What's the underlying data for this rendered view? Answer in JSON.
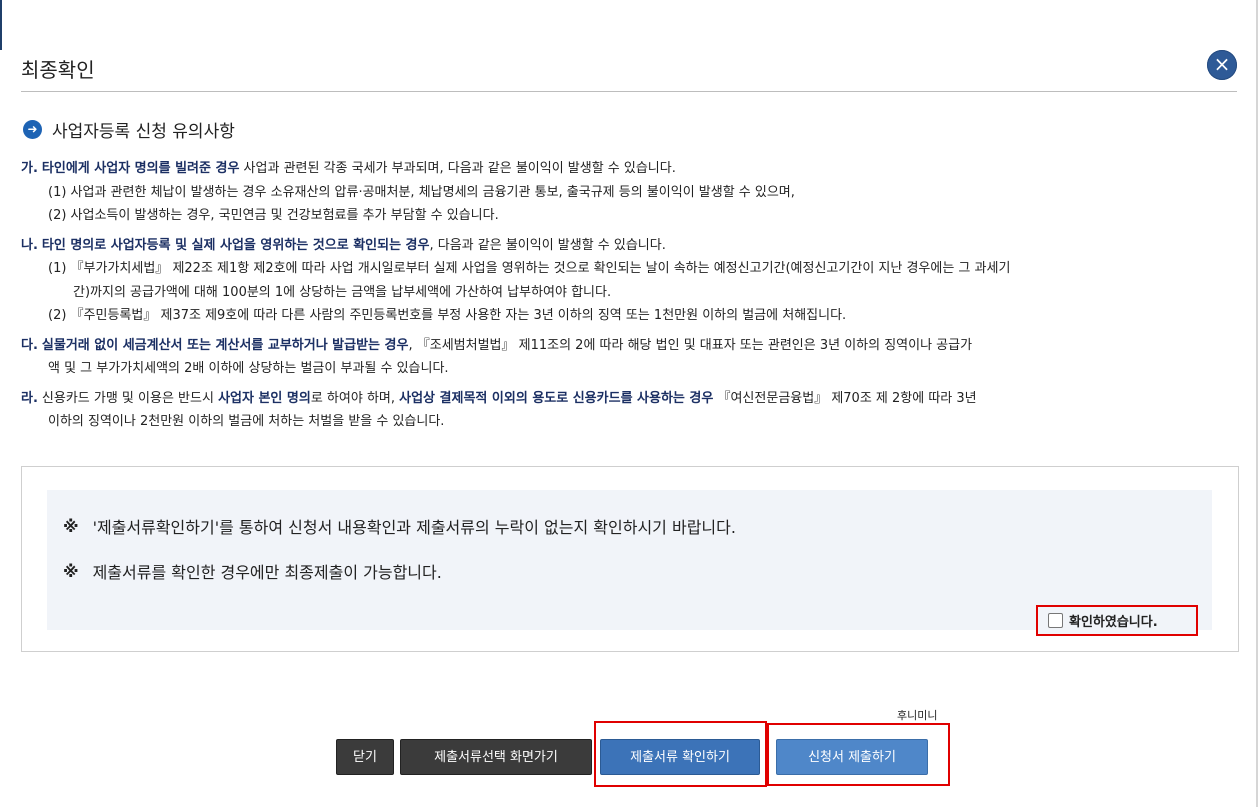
{
  "dialog": {
    "title": "최종확인",
    "close_symbol": "×"
  },
  "icons": {
    "close": "close-icon",
    "section_bullet": "arrow-right-circle-icon"
  },
  "section": {
    "icon_glyph": "➜",
    "title": "사업자등록 신청 유의사항"
  },
  "notice": {
    "ga": {
      "mark": "가.",
      "lead_bold": "타인에게 사업자 명의를 빌려준 경우",
      "lead_rest": " 사업과 관련된 각종 국세가 부과되며, 다음과 같은 불이익이 발생할 수 있습니다.",
      "item1": "(1) 사업과 관련한 체납이 발생하는 경우 소유재산의 압류·공매처분, 체납명세의 금융기관 통보, 출국규제 등의 불이익이 발생할 수 있으며,",
      "item2": "(2) 사업소득이 발생하는 경우, 국민연금 및 건강보험료를 추가 부담할 수 있습니다."
    },
    "na": {
      "mark": "나.",
      "lead_bold": "타인 명의로 사업자등록 및 실제 사업을 영위하는 것으로 확인되는 경우",
      "lead_rest": ", 다음과 같은 불이익이 발생할 수 있습니다.",
      "item1": "(1) 『부가가치세법』 제22조 제1항 제2호에 따라 사업 개시일로부터 실제 사업을 영위하는 것으로 확인되는 날이 속하는 예정신고기간(예정신고기간이 지난 경우에는 그 과세기",
      "item1_cont": "간)까지의 공급가액에 대해 100분의 1에 상당하는 금액을 납부세액에 가산하여 납부하여야 합니다.",
      "item2": "(2) 『주민등록법』 제37조 제9호에 따라 다른 사람의 주민등록번호를 부정 사용한 자는 3년 이하의 징역 또는 1천만원 이하의 벌금에 처해집니다."
    },
    "da": {
      "mark": "다.",
      "lead_bold": "실물거래 없이 세금계산서 또는 계산서를 교부하거나 발급받는 경우",
      "lead_rest": ", 『조세범처벌법』 제11조의 2에 따라 해당 법인 및 대표자 또는 관련인은 3년 이하의 징역이나 공급가",
      "cont": "액 및 그 부가가치세액의 2배 이하에 상당하는 벌금이 부과될 수 있습니다."
    },
    "ra": {
      "mark": "라.",
      "part1": "신용카드 가맹 및 이용은 반드시 ",
      "bold1": "사업자 본인 명의",
      "part2": "로 하여야 하며, ",
      "bold2": "사업상 결제목적 이외의 용도로 신용카드를 사용하는 경우",
      "part3": " 『여신전문금융법』 제70조 제 2항에 따라 3년",
      "cont": "이하의 징역이나 2천만원 이하의 벌금에 처하는 처벌을 받을 수 있습니다."
    }
  },
  "confirm": {
    "ref_mark": "※",
    "line1": "'제출서류확인하기'를 통하여 신청서 내용확인과 제출서류의 누락이 없는지 확인하시기 바랍니다.",
    "line2": "제출서류를 확인한 경우에만 최종제출이 가능합니다.",
    "checkbox_label": "확인하였습니다."
  },
  "footer": {
    "tiny_label": "후니미니",
    "close_label": "닫기",
    "doc_select_label": "제출서류선택 화면가기",
    "doc_check_label": "제출서류 확인하기",
    "submit_label": "신청서 제출하기"
  }
}
